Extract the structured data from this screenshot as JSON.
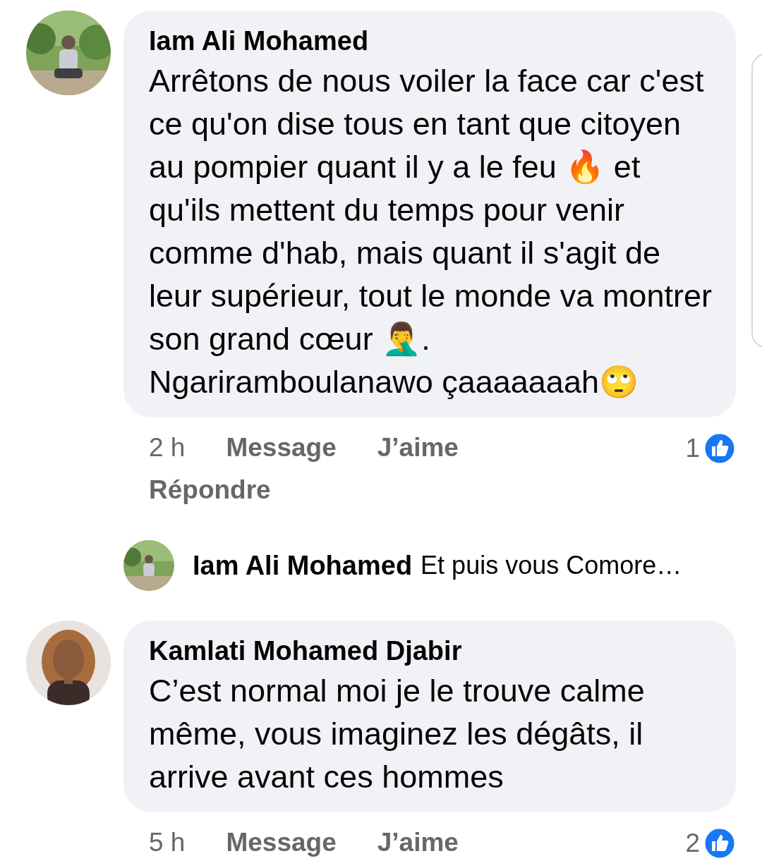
{
  "comments": [
    {
      "author": "Iam Ali Mohamed",
      "text": "Arrêtons de nous voiler la face car c'est ce qu'on dise tous en tant que citoyen au pompier quant il y a le feu 🔥 et qu'ils mettent du temps pour venir comme d'hab, mais quant il s'agit de leur supérieur, tout le monde va montrer son grand cœur 🤦‍♂️. Ngariramboulanawo çaaaaaaah🙄",
      "time": "2 h",
      "actions": [
        "Message",
        "J’aime",
        "Répondre"
      ],
      "reaction_count": "1",
      "replies": [
        {
          "author": "Iam Ali Mohamed",
          "text": "Et puis vous Comore…"
        }
      ]
    },
    {
      "author": "Kamlati Mohamed Djabir",
      "text": "C’est normal moi je le trouve calme même, vous imaginez les dégâts, il arrive avant ces hommes",
      "time": "5 h",
      "actions": [
        "Message",
        "J’aime"
      ],
      "reaction_count": "2"
    }
  ]
}
